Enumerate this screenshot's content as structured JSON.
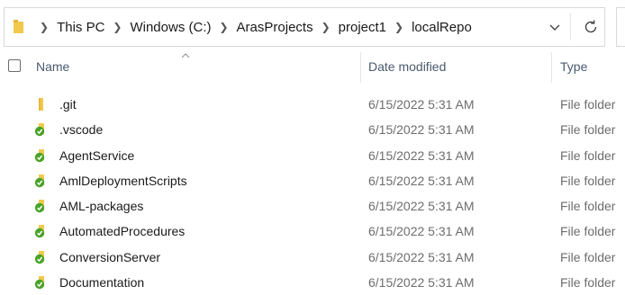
{
  "address_bar": {
    "breadcrumbs": [
      "This PC",
      "Windows (C:)",
      "ArasProjects",
      "project1",
      "localRepo"
    ],
    "folder_icon": "folder-icon",
    "dropdown_icon": "chevron-down-icon",
    "refresh_icon": "refresh-icon"
  },
  "columns": {
    "name": "Name",
    "date_modified": "Date modified",
    "type": "Type"
  },
  "sort": {
    "column": "name",
    "direction": "ascending"
  },
  "files": [
    {
      "name": ".git",
      "date": "6/15/2022 5:31 AM",
      "type": "File folder",
      "icon": "folder-icon"
    },
    {
      "name": ".vscode",
      "date": "6/15/2022 5:31 AM",
      "type": "File folder",
      "icon": "git-synced-folder-icon"
    },
    {
      "name": "AgentService",
      "date": "6/15/2022 5:31 AM",
      "type": "File folder",
      "icon": "git-synced-folder-icon"
    },
    {
      "name": "AmlDeploymentScripts",
      "date": "6/15/2022 5:31 AM",
      "type": "File folder",
      "icon": "git-synced-folder-icon"
    },
    {
      "name": "AML-packages",
      "date": "6/15/2022 5:31 AM",
      "type": "File folder",
      "icon": "git-synced-folder-icon"
    },
    {
      "name": "AutomatedProcedures",
      "date": "6/15/2022 5:31 AM",
      "type": "File folder",
      "icon": "git-synced-folder-icon"
    },
    {
      "name": "ConversionServer",
      "date": "6/15/2022 5:31 AM",
      "type": "File folder",
      "icon": "git-synced-folder-icon"
    },
    {
      "name": "Documentation",
      "date": "6/15/2022 5:31 AM",
      "type": "File folder",
      "icon": "git-synced-folder-icon"
    }
  ],
  "colors": {
    "folder": "#f2c94c",
    "sync_badge": "#4aa329",
    "header_text": "#4a5a6e",
    "meta_text": "#6d6d6d"
  }
}
